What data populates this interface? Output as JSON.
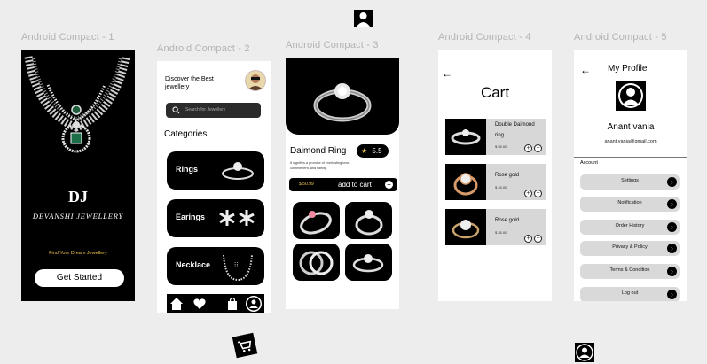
{
  "frames": [
    {
      "label": "Android Compact - 1"
    },
    {
      "label": "Android Compact - 2"
    },
    {
      "label": "Android Compact - 3"
    },
    {
      "label": "Android Compact - 4"
    },
    {
      "label": "Android Compact - 5"
    }
  ],
  "splash": {
    "logo": "DJ",
    "brand": "DEVANSHI JEWELLERY",
    "tagline": "Find Your Dream Jewellery",
    "cta": "Get Started"
  },
  "home": {
    "greeting": "Discover the Best jewellery",
    "search_placeholder": "Search for Jewellery",
    "categories_title": "Categories",
    "categories": [
      {
        "label": "Rings",
        "icon": "ring-icon"
      },
      {
        "label": "Earings",
        "icon": "earring-icon"
      },
      {
        "label": "Necklace",
        "icon": "necklace-icon"
      }
    ],
    "nav": [
      "home-icon",
      "heart-icon",
      "bag-icon",
      "profile-icon"
    ]
  },
  "product": {
    "title": "Daimond Ring",
    "rating": "5.5",
    "description": "It signifies a promise of everlasting love, commitment, and fidelity.",
    "price": "$ 50.99",
    "add_to_cart": "add to cart"
  },
  "cart": {
    "title": "Cart",
    "items": [
      {
        "name": "Double Daimond ring",
        "price": "$ 55.00"
      },
      {
        "name": "Rose gold",
        "price": "$ 45.00"
      },
      {
        "name": "Rose gold",
        "price": "$ 35.00"
      }
    ]
  },
  "profile": {
    "title": "My Profile",
    "name": "Anant vania",
    "email": "anant.vania@gmail.com",
    "section": "Account",
    "menu": [
      "Settings",
      "Notification",
      "Order History",
      "Privacy & Policy",
      "Terms & Condition",
      "Log out"
    ]
  },
  "colors": {
    "gold": "#f2c94c",
    "black": "#000000",
    "canvas": "#ededed",
    "button_grey": "#d9d9d9"
  }
}
